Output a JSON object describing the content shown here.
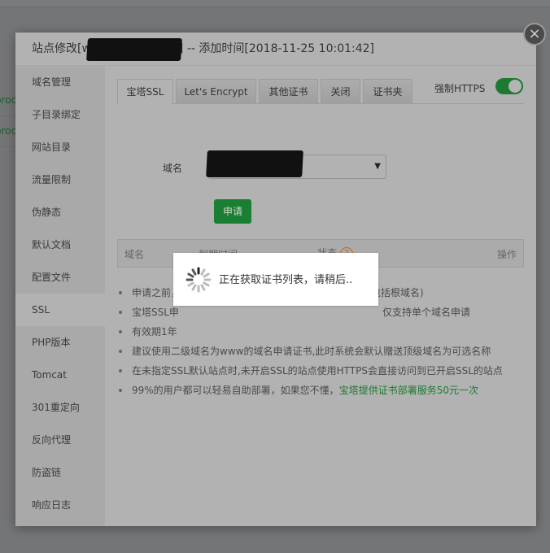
{
  "background": {
    "row_snippets": [
      "proc",
      "proc"
    ]
  },
  "modal": {
    "title_prefix": "站点修改[w",
    "title_suffix": "] -- 添加时间[2018-11-25 10:01:42]",
    "close_icon": "×"
  },
  "sidebar": {
    "items": [
      {
        "label": "域名管理"
      },
      {
        "label": "子目录绑定"
      },
      {
        "label": "网站目录"
      },
      {
        "label": "流量限制"
      },
      {
        "label": "伪静态"
      },
      {
        "label": "默认文档"
      },
      {
        "label": "配置文件"
      },
      {
        "label": "SSL",
        "active": true
      },
      {
        "label": "PHP版本"
      },
      {
        "label": "Tomcat"
      },
      {
        "label": "301重定向"
      },
      {
        "label": "反向代理"
      },
      {
        "label": "防盗链"
      },
      {
        "label": "响应日志"
      }
    ]
  },
  "tabs": [
    {
      "label": "宝塔SSL",
      "active": true
    },
    {
      "label": "Let's Encrypt"
    },
    {
      "label": "其他证书"
    },
    {
      "label": "关闭"
    },
    {
      "label": "证书夹"
    }
  ],
  "force_https": {
    "label": "强制HTTPS",
    "enabled": true
  },
  "form": {
    "domain_label": "域名",
    "domain_value": "",
    "dropdown_icon": "▼",
    "apply_label": "申请"
  },
  "table": {
    "headers": [
      "域名",
      "到期时间",
      "状态",
      "操作"
    ],
    "help_icon": "?"
  },
  "tips": [
    {
      "text": "申请之前，",
      "tail": "包括根域名)"
    },
    {
      "text": "宝塔SSL申",
      "tail": "仅支持单个域名申请"
    },
    {
      "text": "有效期1年",
      "tail": ""
    },
    {
      "text": "建议使用二级域名为www的域名申请证书,此时系统会默认赠送顶级域名为可选名称"
    },
    {
      "text": "在未指定SSL默认站点时,未开启SSL的站点使用HTTPS会直接访问到已开启SSL的站点"
    },
    {
      "text": "99%的用户都可以轻易自助部署，如果您不懂，",
      "link": "宝塔提供证书部署服务50元一次"
    }
  ],
  "colors": {
    "accent_green": "#1b7f33",
    "help_orange": "#c4671a"
  },
  "loading": {
    "text": "正在获取证书列表，请稍后.."
  }
}
